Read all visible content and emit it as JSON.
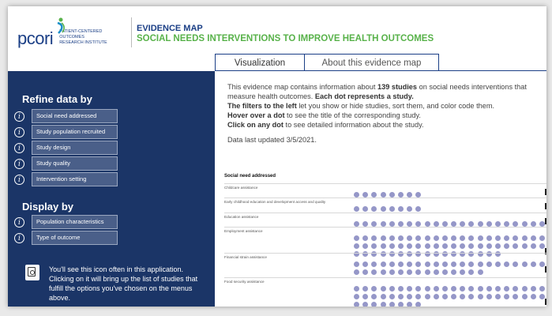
{
  "header": {
    "logo_word": "pcori",
    "logo_sub_line1": "PATIENT-CENTERED OUTCOMES",
    "logo_sub_line2": "RESEARCH INSTITUTE",
    "title_line1": "EVIDENCE MAP",
    "title_line2": "SOCIAL NEEDS INTERVENTIONS TO IMPROVE HEALTH OUTCOMES",
    "brand_blue": "#1b3f86",
    "brand_green": "#58b24a"
  },
  "tabs": [
    {
      "label": "Visualization",
      "active": true
    },
    {
      "label": "About this evidence map",
      "active": false
    }
  ],
  "sidebar": {
    "refine_heading": "Refine data by",
    "filters": [
      "Social need addressed",
      "Study population recruited",
      "Study design",
      "Study quality",
      "Intervention setting"
    ],
    "display_heading": "Display by",
    "display_options": [
      "Population characteristics",
      "Type of outcome"
    ],
    "note": "You'll see this icon often in this application. Clicking on it will bring up the list of studies that fulfill the options you've chosen on the menus above.",
    "bg_color": "#1b3567"
  },
  "intro": {
    "p1_a": "This evidence map contains information about ",
    "p1_count": "139 studies",
    "p1_b": " on social needs interventions that measure health outcomes. ",
    "p1_c": "Each dot represents a study.",
    "p2_a": "The filters to the left",
    "p2_b": " let you show or hide studies, sort them, and color code them.",
    "p3_a": "Hover over a dot",
    "p3_b": " to see the title of the corresponding study.",
    "p4_a": "Click on any dot",
    "p4_b": " to see detailed information about the study.",
    "updated": "Data last updated 3/5/2021."
  },
  "map": {
    "section_title": "Social need addressed",
    "dot_color": "#9597c8",
    "rows": [
      {
        "label": "Childcare assistance",
        "lines": [
          8
        ]
      },
      {
        "label": "Early childhood education and development access and quality",
        "lines": [
          8
        ]
      },
      {
        "label": "Education assistance",
        "lines": [
          22
        ]
      },
      {
        "label": "Employment assistance",
        "lines": [
          22,
          22,
          17
        ]
      },
      {
        "label": "Financial strain assistance",
        "lines": [
          22,
          15
        ]
      },
      {
        "label": "Food security assistance",
        "lines": [
          22,
          22,
          8
        ]
      }
    ]
  }
}
